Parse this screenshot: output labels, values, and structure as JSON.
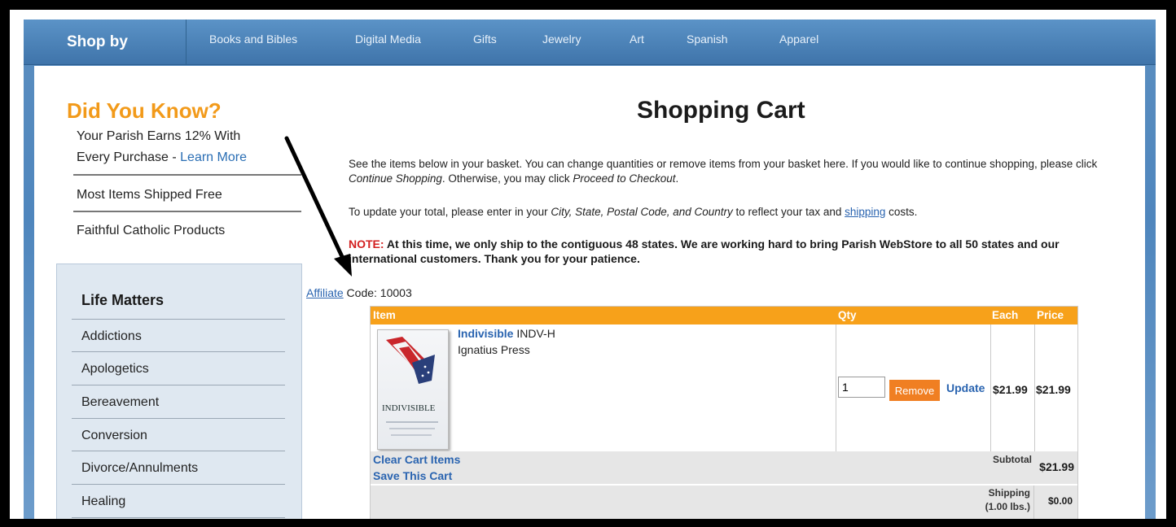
{
  "nav": {
    "shop_by": "Shop by",
    "items": [
      "Books and Bibles",
      "Digital Media",
      "Gifts",
      "Jewelry",
      "Art",
      "Spanish",
      "Apparel"
    ]
  },
  "sidebar": {
    "title": "Did You Know?",
    "fact1_line1": "Your Parish Earns 12% With",
    "fact1_line2": "Every Purchase - ",
    "learn_more": "Learn More",
    "fact2": "Most Items Shipped Free",
    "fact3": "Faithful Catholic Products",
    "life_title": "Life Matters",
    "life_items": [
      "Addictions",
      "Apologetics",
      "Bereavement",
      "Conversion",
      "Divorce/Annulments",
      "Healing"
    ]
  },
  "cart": {
    "title": "Shopping Cart",
    "intro1": "See the items below in your basket.  You can change quantities or remove items from your basket here.  If you would like to continue shopping, please click ",
    "intro_continue": "Continue Shopping",
    "intro2": ".  Otherwise, you may click ",
    "intro_checkout": "Proceed to Checkout",
    "intro3": ".",
    "update1": "To update your total, please enter in your ",
    "update_fields": "City, State, Postal Code, and Country",
    "update2": " to reflect your tax and ",
    "shipping_link": "shipping",
    "update3": " costs.",
    "note_label": "NOTE:",
    "note_text": "  At this time, we only ship to the contiguous 48 states.  We are working hard to bring Parish WebStore to all 50 states and our international customers.  Thank you for your patience.",
    "affiliate_link": "Affiliate",
    "affiliate_code": " Code: 10003",
    "headers": {
      "item": "Item",
      "qty": "Qty",
      "each": "Each",
      "price": "Price"
    },
    "product": {
      "name": "Indivisible",
      "sku": " INDV-H",
      "publisher": "Ignatius Press",
      "cover_title": "INDIVISIBLE",
      "qty": "1",
      "each": "$21.99",
      "price": "$21.99"
    },
    "remove_label": "Remove",
    "update_label": "Update",
    "clear_label": "Clear Cart Items",
    "save_label": "Save This Cart",
    "subtotal_label": "Subtotal",
    "subtotal_value": "$21.99",
    "shipping_label": "Shipping",
    "shipping_weight": "(1.00 lbs.)",
    "shipping_value": "$0.00"
  },
  "colors": {
    "accent": "#f7a11a",
    "link": "#2a64b0",
    "nav": "#4f86bd",
    "note": "#d32020"
  }
}
